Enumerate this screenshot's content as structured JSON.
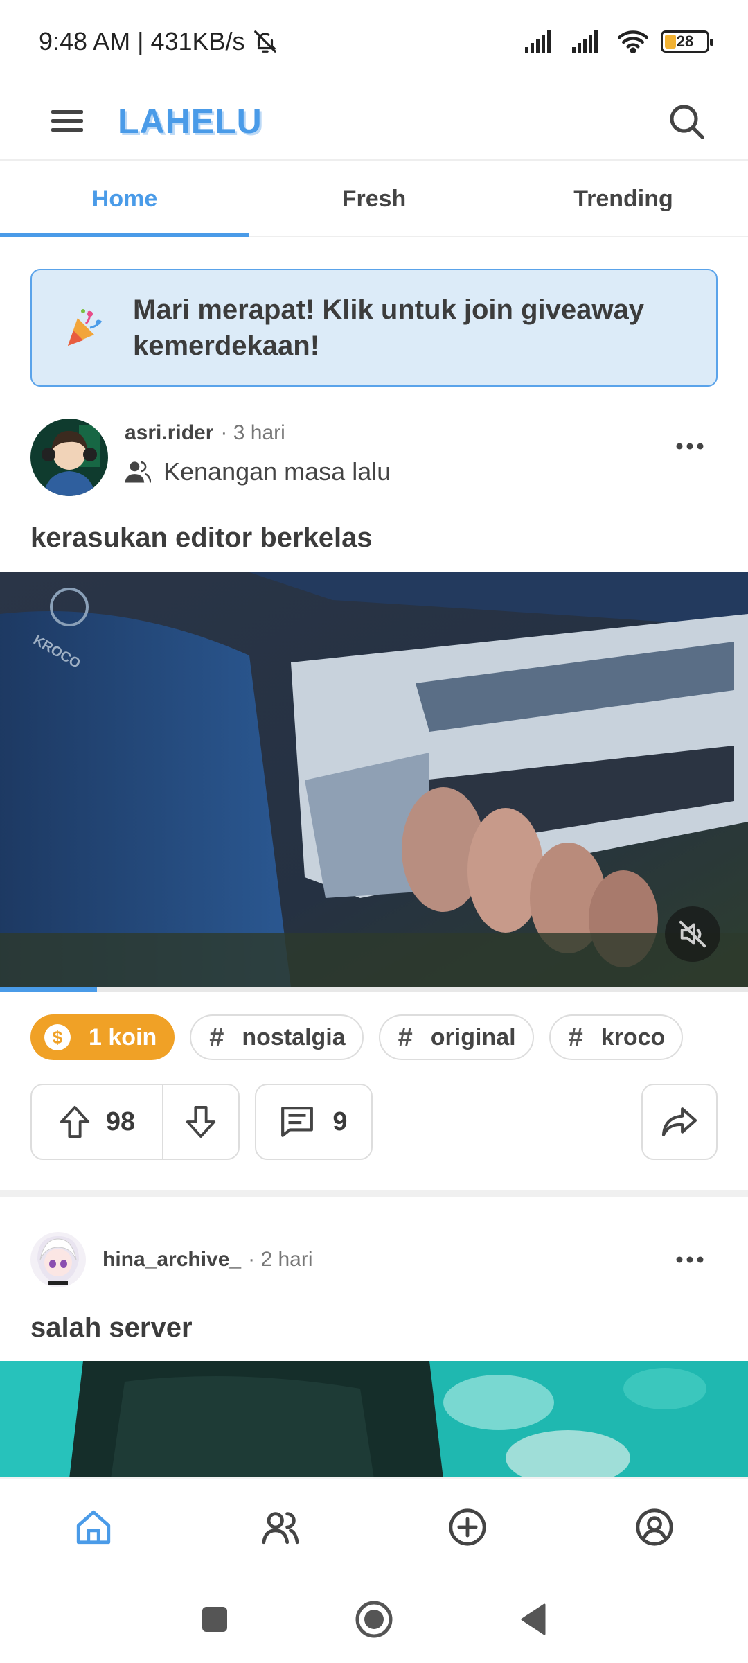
{
  "status_bar": {
    "time_speed": "9:48 AM | 431KB/s",
    "battery_level": "28",
    "battery_fraction": 0.28
  },
  "app": {
    "logo": "LAHELU"
  },
  "tabs": [
    {
      "label": "Home",
      "active": true
    },
    {
      "label": "Fresh",
      "active": false
    },
    {
      "label": "Trending",
      "active": false
    }
  ],
  "banner": {
    "text": "Mari merapat! Klik untuk join giveaway kemerdekaan!",
    "icon": "party-popper-icon"
  },
  "posts": [
    {
      "username": "asri.rider",
      "time": "· 3 hari",
      "community": "Kenangan masa lalu",
      "title": "kerasukan editor berkelas",
      "video_progress": 0.13,
      "coin_label": "1 koin",
      "tags": [
        "nostalgia",
        "original",
        "kroco"
      ],
      "upvotes": "98",
      "comments": "9"
    },
    {
      "username": "hina_archive_",
      "time": "· 2 hari",
      "title": "salah server"
    }
  ],
  "bottom_nav": [
    "home-icon",
    "users-icon",
    "add-circle-icon",
    "profile-icon"
  ],
  "colors": {
    "accent": "#4a9be8",
    "coin": "#f0a126",
    "banner_bg": "#dcebf8"
  }
}
